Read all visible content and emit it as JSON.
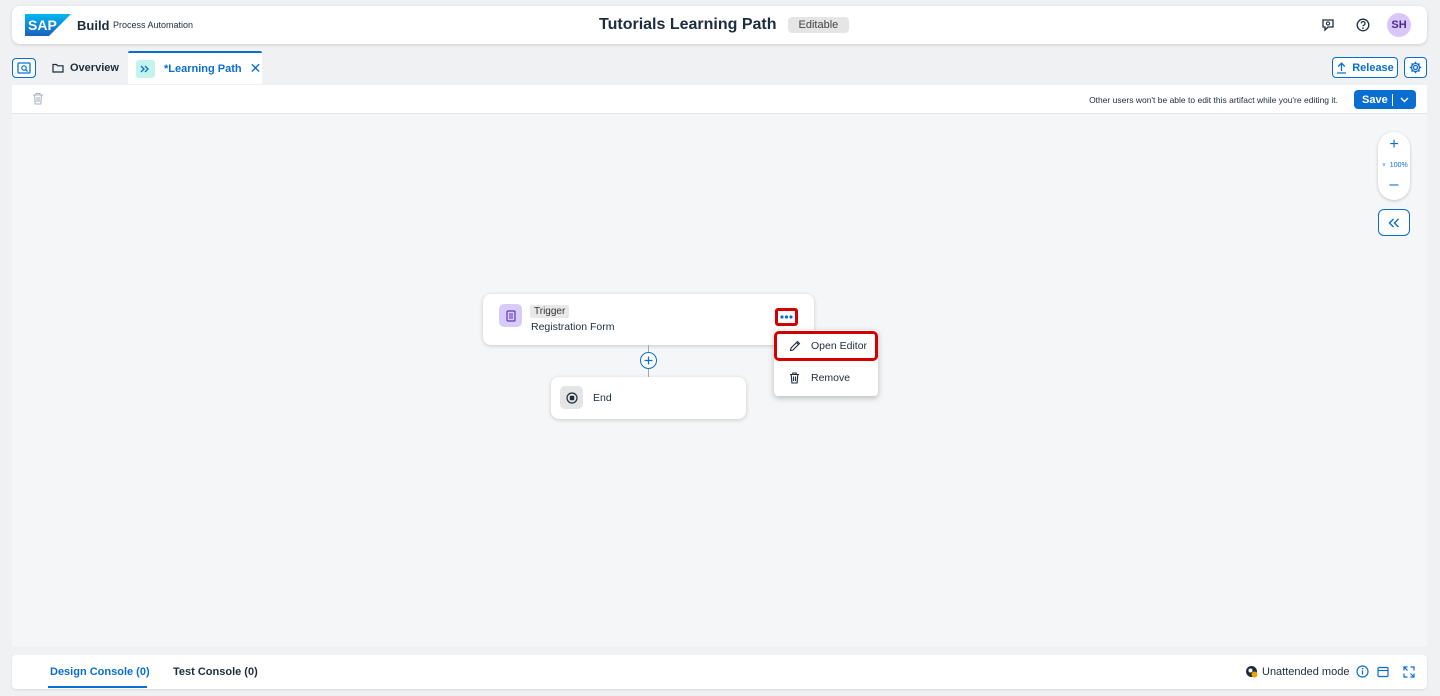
{
  "shell": {
    "logo_text": "SAP",
    "brand": "Build",
    "product": "Process Automation",
    "title": "Tutorials Learning Path",
    "status_badge": "Editable",
    "avatar_initials": "SH"
  },
  "tabs": {
    "overview_label": "Overview",
    "active_label": "*Learning Path",
    "close_symbol": "✕"
  },
  "actions": {
    "release_label": "Release",
    "save_label": "Save"
  },
  "toolbar": {
    "edit_message": "Other users won't be able to edit this artifact while you're editing it."
  },
  "canvas": {
    "zoom_level": "100%",
    "trigger_node": {
      "type_label": "Trigger",
      "name": "Registration Form"
    },
    "end_node": {
      "label": "End"
    },
    "context_menu": {
      "open_editor": "Open Editor",
      "remove": "Remove"
    }
  },
  "console": {
    "design_tab": "Design Console (0)",
    "test_tab": "Test Console (0)",
    "mode_label": "Unattended mode"
  },
  "colors": {
    "accent": "#0a6ed1",
    "highlight": "#d40000",
    "trigger_icon_bg": "#d9cbf7",
    "tab_icon_bg": "#c5f2ed"
  }
}
